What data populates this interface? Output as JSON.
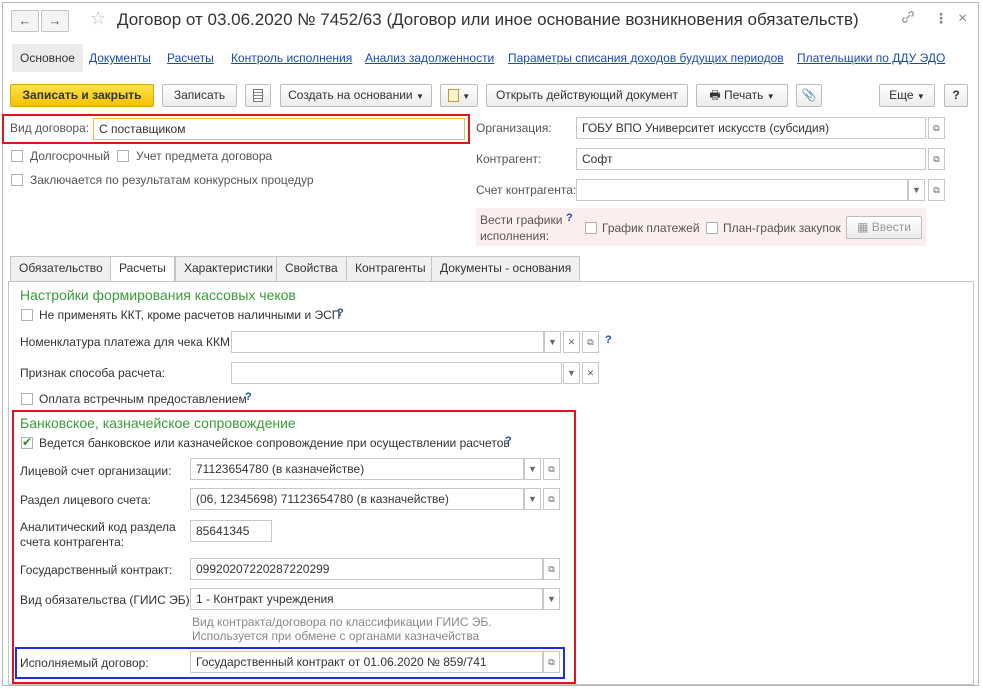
{
  "window": {
    "title": "Договор от 03.06.2020 № 7452/63 (Договор или иное основание возникновения обязательств)",
    "nav_back": "←",
    "nav_forward": "→",
    "star": "☆",
    "link": "🔗",
    "more": "⋮",
    "close": "×"
  },
  "section_tabs": [
    {
      "label": "Основное"
    },
    {
      "label": "Документы"
    },
    {
      "label": "Расчеты"
    },
    {
      "label": "Контроль исполнения"
    },
    {
      "label": "Анализ задолженности"
    },
    {
      "label": "Параметры списания доходов будущих периодов"
    },
    {
      "label": "Плательщики по ДДУ ЭДО"
    }
  ],
  "toolbar": {
    "save_close": "Записать и закрыть",
    "save": "Записать",
    "create_based": "Создать на основании",
    "open_current": "Открыть действующий документ",
    "print": "Печать",
    "more": "Еще",
    "help": "?"
  },
  "header": {
    "contract_kind_label": "Вид договора:",
    "contract_kind_value": "С поставщиком",
    "long_term": "Долгосрочный",
    "subject_accounting": "Учет предмета договора",
    "tender": "Заключается по результатам конкурсных процедур",
    "org_label": "Организация:",
    "org_value": "ГОБУ ВПО Университет искусств (субсидия)",
    "counterparty_label": "Контрагент:",
    "counterparty_value": "Софт",
    "cp_account_label": "Счет контрагента:",
    "cp_account_value": "",
    "schedules_label_1": "Вести графики",
    "schedules_label_2": "исполнения:",
    "payment_schedule": "График платежей",
    "procurement_plan": "План-график закупок",
    "enter_button": "Ввести"
  },
  "tabs": [
    {
      "label": "Обязательство"
    },
    {
      "label": "Расчеты"
    },
    {
      "label": "Характеристики"
    },
    {
      "label": "Свойства"
    },
    {
      "label": "Контрагенты"
    },
    {
      "label": "Документы - основания"
    }
  ],
  "cash_receipts": {
    "heading": "Настройки формирования кассовых чеков",
    "no_kkt": "Не применять ККТ, кроме расчетов наличными и ЭСП",
    "nomenclature_label": "Номенклатура платежа для чека ККМ:",
    "nomenclature_value": "",
    "method_label": "Признак способа расчета:",
    "method_value": "",
    "counter_provision": "Оплата встречным предоставлением"
  },
  "bank_support": {
    "heading": "Банковское, казначейское сопровождение",
    "enabled_label": "Ведется банковское или казначейское сопровождение при осуществлении расчетов",
    "enabled": true,
    "personal_account_label": "Лицевой счет организации:",
    "personal_account_value": "71123654780 (в казначействе)",
    "section_label": "Раздел лицевого счета:",
    "section_value": "(06, 12345698) 71123654780 (в казначействе)",
    "analytic_label_1": "Аналитический код раздела",
    "analytic_label_2": "счета контрагента:",
    "analytic_value": "85641345",
    "gov_contract_label": "Государственный контракт:",
    "gov_contract_value": "09920207220287220299",
    "obligation_label": "Вид обязательства (ГИИС ЭБ):",
    "obligation_value": "1 - Контракт учреждения",
    "hint_1": "Вид контракта/договора по классификации ГИИС ЭБ.",
    "hint_2": "Используется при обмене с органами казначейства",
    "executed_label": "Исполняемый договор:",
    "executed_value": "Государственный контракт от 01.06.2020 № 859/741"
  }
}
